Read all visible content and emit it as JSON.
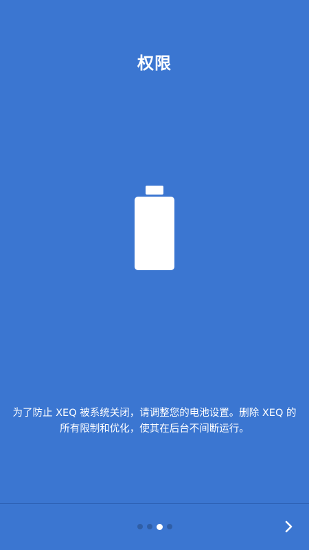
{
  "page": {
    "title": "权限",
    "description": "为了防止 XEQ 被系统关闭，请调整您的电池设置。删除 XEQ 的所有限制和优化，使其在后台不间断运行。"
  },
  "illustration": {
    "icon": "battery-icon"
  },
  "pager": {
    "total_pages": 4,
    "current_page": 3
  },
  "navigation": {
    "next_icon": "chevron-right-icon"
  },
  "colors": {
    "background": "#3b76d1",
    "text": "#ffffff",
    "dot_inactive": "#2f5ea6",
    "dot_active": "#ffffff"
  }
}
